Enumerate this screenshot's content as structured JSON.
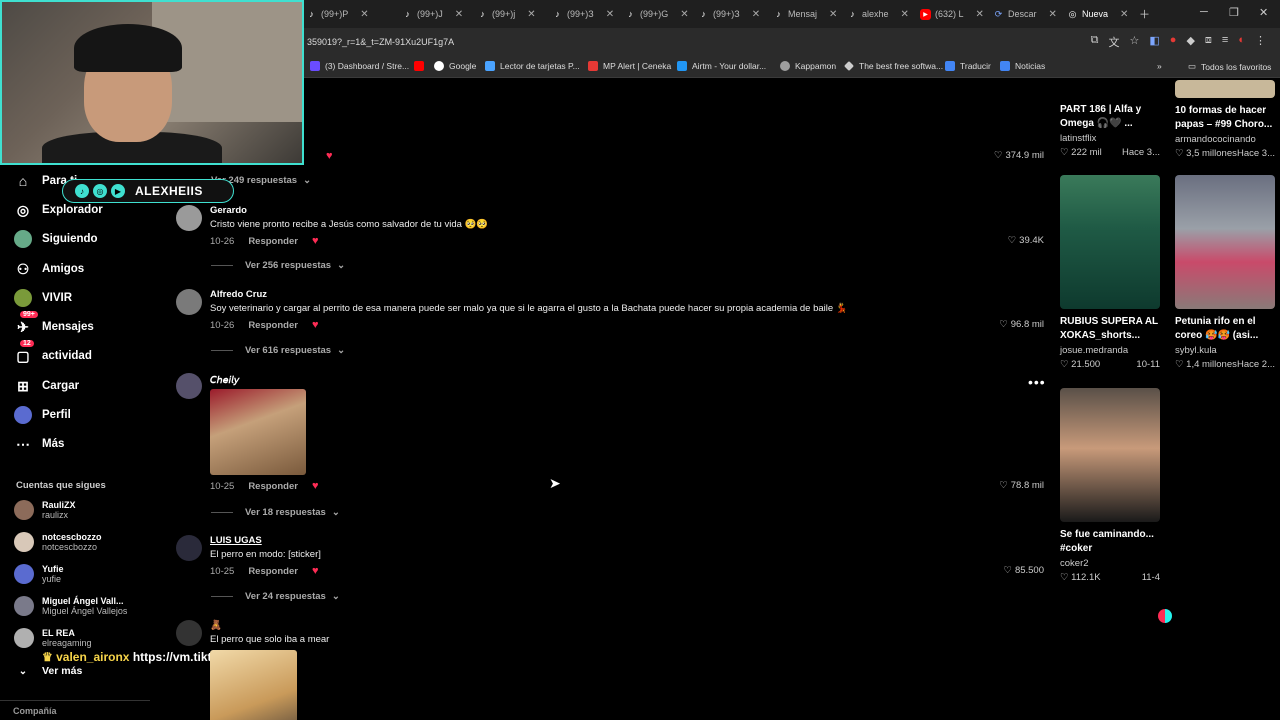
{
  "browser": {
    "tabs": [
      {
        "label": "(99+)P",
        "icon": "tiktok-icon"
      },
      {
        "label": "(99+)J",
        "icon": "tiktok-icon"
      },
      {
        "label": "(99+)ј",
        "icon": "tiktok-icon"
      },
      {
        "label": "(99+)З",
        "icon": "tiktok-icon"
      },
      {
        "label": "(99+)G",
        "icon": "tiktok-icon"
      },
      {
        "label": "(99+)З",
        "icon": "tiktok-icon"
      },
      {
        "label": "Mensaj",
        "icon": "tiktok-icon"
      },
      {
        "label": "alexhe",
        "icon": "tiktok-icon"
      },
      {
        "label": "(632) L",
        "icon": "youtube-icon"
      },
      {
        "label": "Descar",
        "icon": "download-icon"
      },
      {
        "label": "Nueva",
        "icon": "globe-icon"
      }
    ],
    "url": "359019?_r=1&_t=ZM-91Xu2UF1g7A",
    "bookmarks": [
      {
        "label": "(3) Dashboard / Stre...",
        "color": "#6a4cff"
      },
      {
        "label": "",
        "color": "#ff0000"
      },
      {
        "label": "Google",
        "color": "#ffffff"
      },
      {
        "label": "Lector de tarjetas P...",
        "color": "#4aa3ff"
      },
      {
        "label": "MP Alert | Ceneka",
        "color": "#e53935"
      },
      {
        "label": "Airtm - Your dollar...",
        "color": "#2196f3"
      },
      {
        "label": "Kappamon",
        "color": "#9e9e9e"
      },
      {
        "label": "The best free softwa...",
        "color": "#cccccc"
      },
      {
        "label": "Traducir",
        "color": "#4285f4"
      },
      {
        "label": "Noticias",
        "color": "#4285f4"
      }
    ],
    "all_bookmarks": "Todos los favoritos"
  },
  "streamer": {
    "name": "ALEXHEIIS"
  },
  "chat_overlay": {
    "name": "valen_aironx",
    "message": "https://vm.tiktok.con"
  },
  "sidebar": {
    "items": [
      {
        "label": "Para ti",
        "icon": "home-icon"
      },
      {
        "label": "Explorador",
        "icon": "compass-icon"
      },
      {
        "label": "Siguiendo",
        "icon": "avatar-icon"
      },
      {
        "label": "Amigos",
        "icon": "friends-icon"
      },
      {
        "label": "VIVIR",
        "icon": "live-icon"
      },
      {
        "label": "Mensajes",
        "icon": "message-icon",
        "badge": "99+"
      },
      {
        "label": "actividad",
        "icon": "activity-icon",
        "badge": "12"
      },
      {
        "label": "Cargar",
        "icon": "upload-icon"
      },
      {
        "label": "Perfil",
        "icon": "profile-icon"
      },
      {
        "label": "Más",
        "icon": "more-icon"
      }
    ],
    "following_header": "Cuentas que sigues",
    "following": [
      {
        "name": "RauliZX",
        "user": "raulizx",
        "color": "#8c6b5a"
      },
      {
        "name": "notcescbozzo",
        "user": "notcescbozzo",
        "color": "#d8c8b8"
      },
      {
        "name": "Yufie",
        "user": "yufie",
        "color": "#5a6bd0"
      },
      {
        "name": "Miguel Ángel Vall...",
        "user": "Miguel Ángel Vallejos",
        "color": "#7a7a8a"
      },
      {
        "name": "EL REA",
        "user": "elreagaming",
        "color": "#b0b0b0"
      }
    ],
    "see_more": "Ver más",
    "company": "Compañía"
  },
  "comments": [
    {
      "name": "",
      "text": "",
      "date": "",
      "reply": "",
      "likes": "374.9 mil",
      "replies": "Ver 249 respuestas"
    },
    {
      "name": "Gerardo",
      "text": "Cristo viene pronto recibe a Jesús como salvador de tu vida 🥺🥺",
      "date": "10-26",
      "reply": "Responder",
      "likes": "39.4K",
      "replies": "Ver 256 respuestas"
    },
    {
      "name": "Alfredo Cruz",
      "text": "Soy veterinario y cargar al perrito de esa manera puede ser malo ya que si le agarra el gusto a la Bachata puede hacer su propia academia de baile 💃",
      "date": "10-26",
      "reply": "Responder",
      "likes": "96.8 mil",
      "replies": "Ver 616 respuestas"
    },
    {
      "name": "𝘊𝘩𝘦𝘪𝘭𝘺",
      "text": "",
      "date": "10-25",
      "reply": "Responder",
      "likes": "78.8 mil",
      "replies": "Ver 18 respuestas"
    },
    {
      "name": "LUIS UGAS",
      "text": "El perro en modo: [sticker]",
      "date": "10-25",
      "reply": "Responder",
      "likes": "85.500",
      "replies": "Ver 24 respuestas"
    },
    {
      "name": "🧸",
      "text": "El perro que solo iba a mear",
      "date": "",
      "reply": "",
      "likes": "",
      "replies": ""
    }
  ],
  "videos": [
    {
      "title": "PART 186 | Alfa y Omega 🎧🖤 ...",
      "user": "latinstflix",
      "likes": "222 mil",
      "time": "Hace 3..."
    },
    {
      "title": "10 formas de hacer papas – #99 Choro...",
      "user": "armandococinando",
      "likes": "3,5 millones",
      "time": "Hace 3..."
    },
    {
      "title": "RUBIUS SUPERA AL XOKAS_shorts...",
      "user": "josue.medranda",
      "likes": "21.500",
      "time": "10-11"
    },
    {
      "title": "Petunia rifo en el coreo 🥵🥵 (asi...",
      "user": "sybyl.kula",
      "likes": "1,4 millones",
      "time": "Hace 2..."
    },
    {
      "title": "Se fue caminando... #coker",
      "user": "coker2",
      "likes": "112.1K",
      "time": "11-4"
    }
  ]
}
